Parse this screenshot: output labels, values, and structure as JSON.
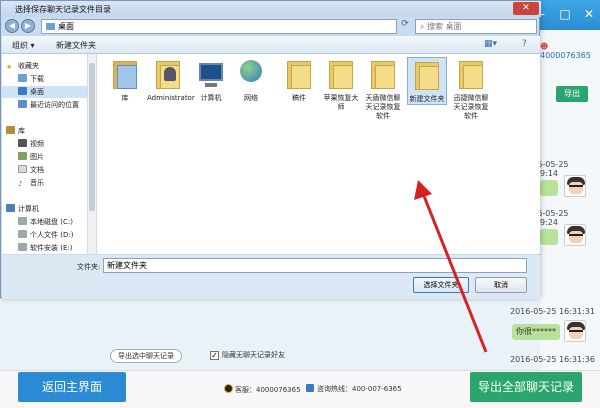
{
  "dialog": {
    "title": "选择保存聊天记录文件目录",
    "address": "桌面",
    "search_placeholder": "搜索 桌面",
    "toolbar": {
      "organize": "组织 ▾",
      "new_folder": "新建文件夹"
    },
    "nav": [
      {
        "label": "收藏夹",
        "icon": "star-icon"
      },
      {
        "label": "下载",
        "icon": "download-folder-icon"
      },
      {
        "label": "桌面",
        "icon": "desktop-icon"
      },
      {
        "label": "最近访问的位置",
        "icon": "recent-places-icon"
      },
      {
        "label": "库",
        "icon": "library-icon"
      },
      {
        "label": "视频",
        "icon": "video-icon"
      },
      {
        "label": "图片",
        "icon": "picture-icon"
      },
      {
        "label": "文档",
        "icon": "document-icon"
      },
      {
        "label": "音乐",
        "icon": "music-icon"
      },
      {
        "label": "计算机",
        "icon": "computer-icon"
      },
      {
        "label": "本地磁盘 (C:)",
        "icon": "drive-icon"
      },
      {
        "label": "个人文件 (D:)",
        "icon": "drive-icon"
      },
      {
        "label": "软件安装 (E:)",
        "icon": "drive-icon"
      }
    ],
    "files": [
      {
        "name": "库",
        "icon": "library-icon"
      },
      {
        "name": "Administrator",
        "icon": "user-folder-icon"
      },
      {
        "name": "计算机",
        "icon": "computer-icon"
      },
      {
        "name": "网络",
        "icon": "network-icon"
      },
      {
        "name": "稿件",
        "icon": "folder-icon"
      },
      {
        "name": "苹果恢复大师",
        "icon": "folder-icon"
      },
      {
        "name": "天盾微信聊天记录恢复软件",
        "icon": "folder-icon"
      },
      {
        "name": "新建文件夹",
        "icon": "folder-icon"
      },
      {
        "name": "迅捷微信聊天记录恢复软件",
        "icon": "folder-icon"
      }
    ],
    "filename_label": "文件夹:",
    "filename_value": "新建文件夹",
    "select_button": "选择文件夹",
    "cancel_button": "取消",
    "close_button": "✕"
  },
  "background": {
    "contact_id": "4000076365",
    "export_small": "导出",
    "timestamps": [
      "2016-05-25 16:29:14",
      "2016-05-25 16:29:24",
      "2016-05-25 16:31:31",
      "2016-05-25 16:31:36"
    ],
    "bubble_text": "你很******",
    "export_selected": "导出选中聊天记录",
    "hide_nonchat": "隐藏无聊天记录好友",
    "back_button": "返回主界面",
    "export_all_button": "导出全部聊天记录",
    "qq_label": "客服：4000076365",
    "hotline_label": "咨询热线：400-007-6365",
    "window_controls": [
      "—",
      "□",
      "✕"
    ]
  },
  "colors": {
    "accent_blue": "#2a8bd4",
    "accent_green": "#2aa56d",
    "arrow_red": "#d42323"
  }
}
